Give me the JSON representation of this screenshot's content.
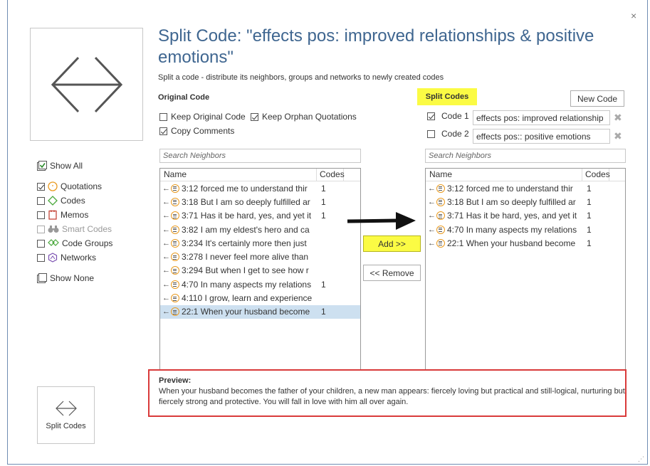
{
  "dialog": {
    "title": "Split Code: \"effects pos: improved relationships & positive emotions\"",
    "subtitle": "Split a code - distribute its neighbors, groups and networks to newly created codes",
    "close_glyph": "×"
  },
  "original": {
    "label": "Original Code",
    "keep_original": {
      "label": "Keep Original Code",
      "checked": false
    },
    "keep_orphan": {
      "label": "Keep Orphan Quotations",
      "checked": true
    },
    "copy_comments": {
      "label": "Copy Comments",
      "checked": true
    }
  },
  "split": {
    "label": "Split Codes",
    "new_code_button": "New Code",
    "codes": [
      {
        "label": "Code 1",
        "checked": true,
        "value": "effects pos: improved relationship"
      },
      {
        "label": "Code 2",
        "checked": false,
        "value": "effects pos:: positive emotions"
      }
    ]
  },
  "search": {
    "left_placeholder": "Search Neighbors",
    "right_placeholder": "Search Neighbors"
  },
  "list_headers": {
    "name": "Name",
    "codes": "Codes"
  },
  "left_list": [
    {
      "name": "3:12 forced me to understand thir",
      "codes": "1"
    },
    {
      "name": "3:18 But I am so deeply fulfilled ar",
      "codes": "1"
    },
    {
      "name": "3:71 Has it be hard, yes, and yet it",
      "codes": "1"
    },
    {
      "name": "3:82 I am my eldest's hero and ca",
      "codes": ""
    },
    {
      "name": "3:234 It's certainly more then just",
      "codes": ""
    },
    {
      "name": "3:278 I never feel more alive than",
      "codes": ""
    },
    {
      "name": "3:294 But when I get to see how r",
      "codes": ""
    },
    {
      "name": "4:70 In many aspects my relations",
      "codes": "1"
    },
    {
      "name": "4:110 I grow, learn and experience",
      "codes": ""
    },
    {
      "name": "22:1 When your husband become",
      "codes": "1"
    }
  ],
  "right_list": [
    {
      "name": "3:12 forced me to understand thir",
      "codes": "1"
    },
    {
      "name": "3:18 But I am so deeply fulfilled ar",
      "codes": "1"
    },
    {
      "name": "3:71 Has it be hard, yes, and yet it",
      "codes": "1"
    },
    {
      "name": "4:70 In many aspects my relations",
      "codes": "1"
    },
    {
      "name": "22:1 When your husband become",
      "codes": "1"
    }
  ],
  "buttons": {
    "add": "Add >>",
    "remove": "<< Remove"
  },
  "filters": {
    "show_all": "Show All",
    "quotations": "Quotations",
    "codes": "Codes",
    "memos": "Memos",
    "smart_codes": "Smart Codes",
    "code_groups": "Code Groups",
    "networks": "Networks",
    "show_none": "Show None"
  },
  "preview": {
    "label": "Preview:",
    "text": "When your husband becomes the father of your children, a new man appears: fiercely loving but practical and still-logical, nurturing but fiercely strong and protective. You will fall in love with him all over again."
  },
  "split_codes_action": "Split Codes",
  "colors": {
    "title": "#3f6690",
    "highlight": "#fbfb44",
    "preview_border": "#d93a3a",
    "quotation_icon": "#e99a1f",
    "selected_row": "#cde0f0"
  }
}
